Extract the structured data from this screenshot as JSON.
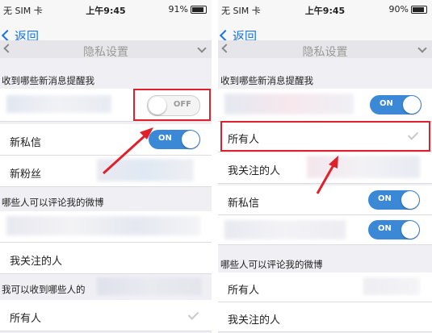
{
  "left": {
    "status": {
      "carrier": "无 SIM 卡",
      "time": "上午9:45",
      "battery": "91%"
    },
    "nav": {
      "back": "返回",
      "title": "隐私设置"
    },
    "sections": {
      "notify": "收到哪些新消息提醒我",
      "comment": "哪些人可以评论我的微博",
      "visibility": "我可以收到哪些人的"
    },
    "rows": {
      "notify_toggle": "OFF",
      "private_msg": "新私信",
      "private_msg_toggle": "ON",
      "new_fans": "新粉丝",
      "followed": "我关注的人",
      "everyone": "所有人"
    }
  },
  "right": {
    "status": {
      "carrier": "无 SIM 卡",
      "time": "上午9:45",
      "battery": "90%"
    },
    "nav": {
      "back": "返回",
      "title": "隐私设置"
    },
    "sections": {
      "notify": "收到哪些新消息提醒我",
      "comment": "哪些人可以评论我的微博"
    },
    "rows": {
      "notify_toggle": "ON",
      "everyone": "所有人",
      "followed": "我关注的人",
      "private_msg": "新私信",
      "private_msg_toggle": "ON",
      "second_toggle": "ON",
      "comment_everyone": "所有人",
      "comment_followed": "我关注的人"
    }
  },
  "colors": {
    "accent": "#3a88d6",
    "highlight": "#e0202a",
    "link": "#1a73e8"
  }
}
